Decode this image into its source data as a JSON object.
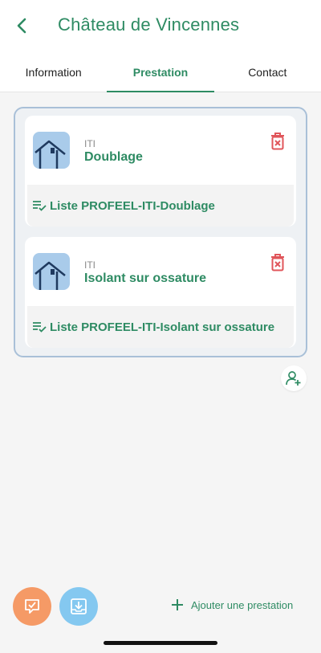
{
  "header": {
    "title": "Château de Vincennes",
    "back_icon": "chevron-left-icon"
  },
  "tabs": [
    {
      "label": "Information",
      "active": false
    },
    {
      "label": "Prestation",
      "active": true
    },
    {
      "label": "Contact",
      "active": false
    }
  ],
  "prestations": [
    {
      "category": "ITI",
      "name": "Doublage",
      "list_label": "Liste PROFEEL-ITI-Doublage"
    },
    {
      "category": "ITI",
      "name": "Isolant sur ossature",
      "list_label": "Liste PROFEEL-ITI-Isolant sur ossature"
    }
  ],
  "actions": {
    "add_prestation_label": "Ajouter une prestation"
  },
  "colors": {
    "accent": "#2e8b63",
    "delete": "#e0555a",
    "fab_orange": "#f59a66",
    "fab_blue": "#84c8f0"
  }
}
